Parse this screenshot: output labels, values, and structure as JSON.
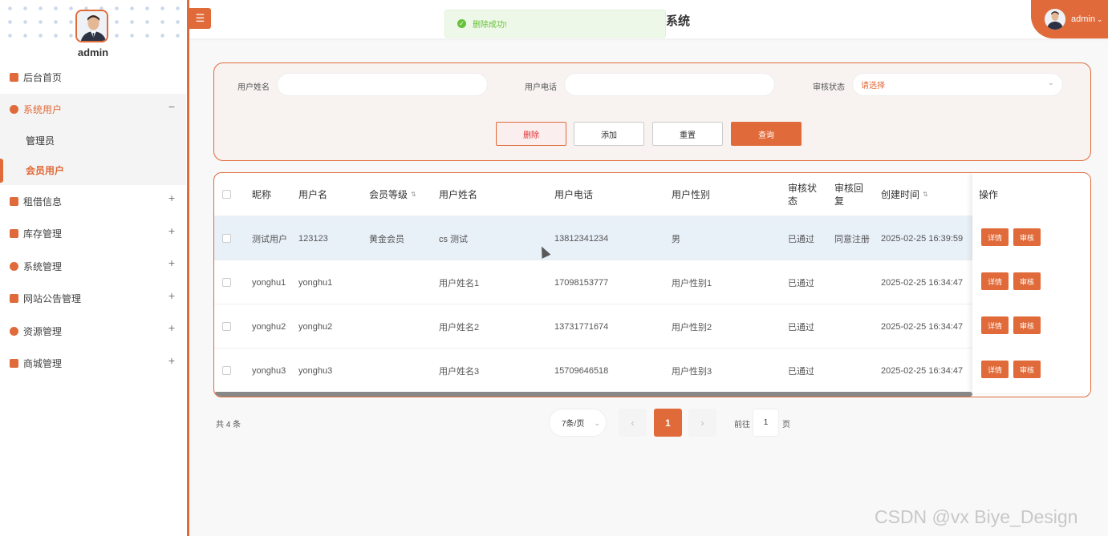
{
  "sidebar": {
    "username": "admin",
    "items": [
      {
        "label": "后台首页",
        "toggle": ""
      },
      {
        "label": "系统用户",
        "toggle": "−"
      },
      {
        "label": "租借信息",
        "toggle": "+"
      },
      {
        "label": "库存管理",
        "toggle": "+"
      },
      {
        "label": "系统管理",
        "toggle": "+"
      },
      {
        "label": "网站公告管理",
        "toggle": "+"
      },
      {
        "label": "资源管理",
        "toggle": "+"
      },
      {
        "label": "商城管理",
        "toggle": "+"
      }
    ],
    "sub_items": [
      "管理员",
      "会员用户"
    ]
  },
  "header": {
    "menu_icon": "☰",
    "title": "系统",
    "toast": "删除成功!",
    "user": "admin"
  },
  "search": {
    "name_label": "用户姓名",
    "name_value": "",
    "phone_label": "用户电话",
    "phone_value": "",
    "status_label": "审核状态",
    "status_placeholder": "请选择",
    "buttons": {
      "delete": "删除",
      "add": "添加",
      "reset": "重置",
      "query": "查询"
    }
  },
  "table": {
    "headers": [
      "昵称",
      "用户名",
      "会员等级",
      "用户姓名",
      "用户电话",
      "用户性别",
      "审核状态",
      "审核回复",
      "创建时间",
      "操作"
    ],
    "rows": [
      {
        "nickname": "测试用户",
        "username": "123123",
        "level": "黄金会员",
        "name": "cs 测试",
        "phone": "13812341234",
        "gender": "男",
        "status": "已通过",
        "reply": "同意注册",
        "created": "2025-02-25 16:39:59"
      },
      {
        "nickname": "yonghu1",
        "username": "yonghu1",
        "level": "",
        "name": "用户姓名1",
        "phone": "17098153777",
        "gender": "用户性别1",
        "status": "已通过",
        "reply": "",
        "created": "2025-02-25 16:34:47"
      },
      {
        "nickname": "yonghu2",
        "username": "yonghu2",
        "level": "",
        "name": "用户姓名2",
        "phone": "13731771674",
        "gender": "用户性别2",
        "status": "已通过",
        "reply": "",
        "created": "2025-02-25 16:34:47"
      },
      {
        "nickname": "yonghu3",
        "username": "yonghu3",
        "level": "",
        "name": "用户姓名3",
        "phone": "15709646518",
        "gender": "用户性别3",
        "status": "已通过",
        "reply": "",
        "created": "2025-02-25 16:34:47"
      }
    ],
    "action_labels": {
      "detail": "详情",
      "review": "审核"
    }
  },
  "pagination": {
    "total": "共 4 条",
    "page_size": "7条/页",
    "current_page": "1",
    "goto_prefix": "前往",
    "goto_value": "1",
    "goto_suffix": "页"
  },
  "watermark": "CSDN @vx Biye_Design",
  "colors": {
    "accent": "#e06a39",
    "success": "#67c23a"
  }
}
